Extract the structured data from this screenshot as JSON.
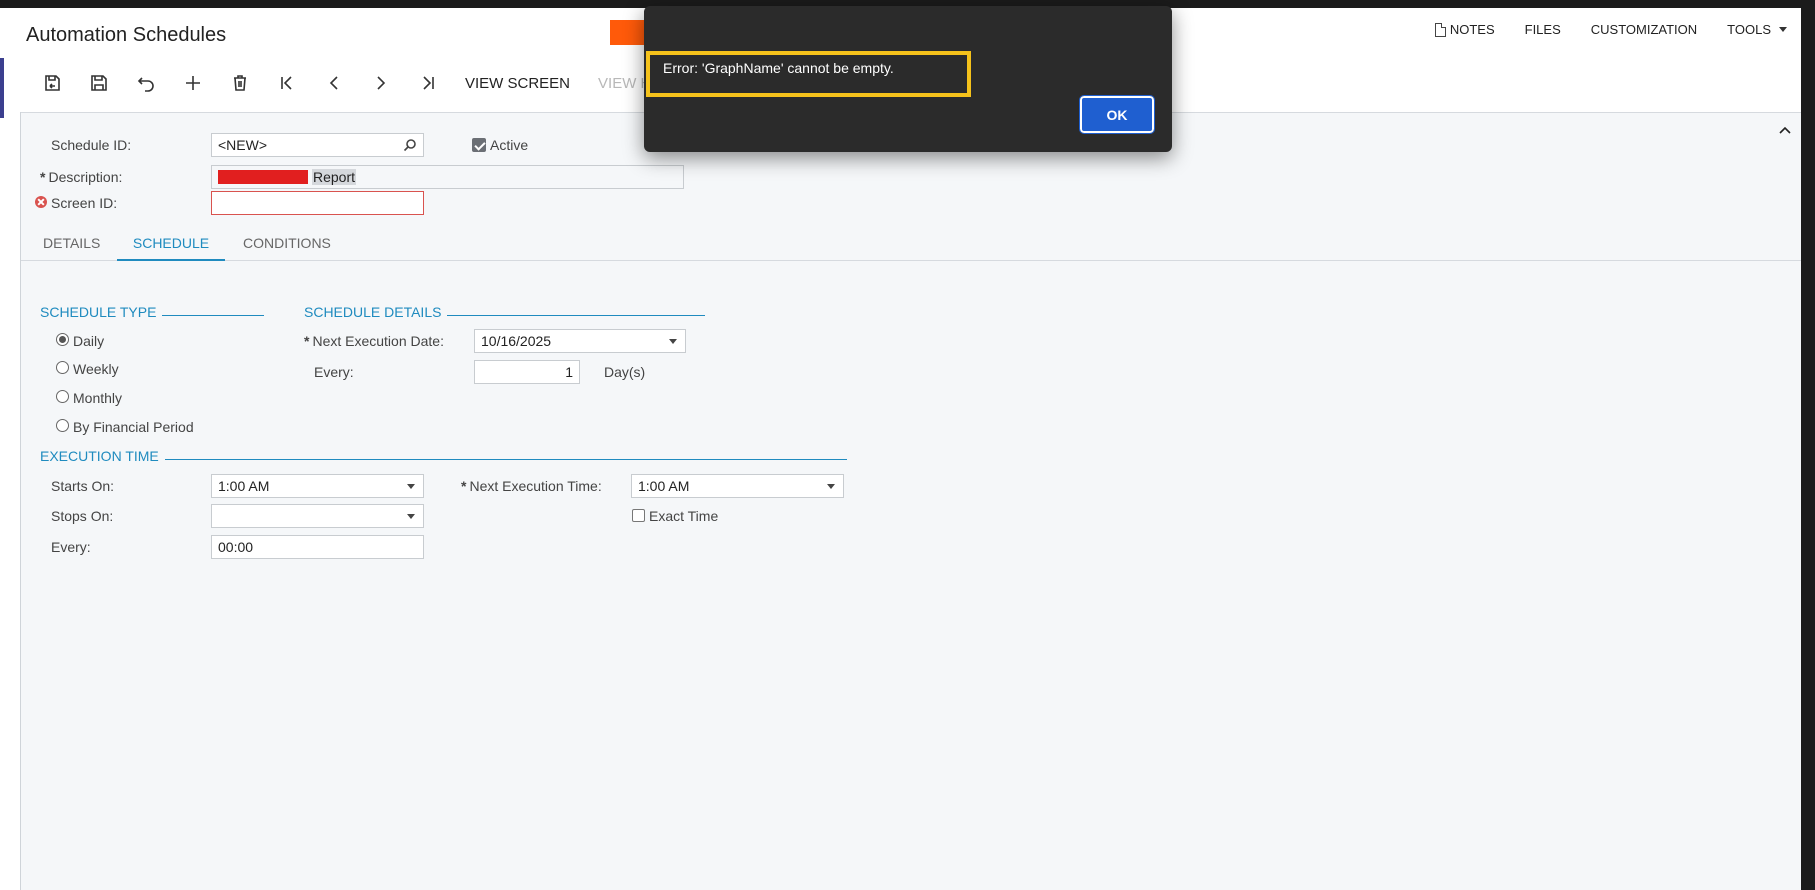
{
  "header": {
    "title": "Automation Schedules",
    "links": {
      "notes": "NOTES",
      "files": "FILES",
      "customization": "CUSTOMIZATION",
      "tools": "TOOLS"
    }
  },
  "toolbar": {
    "icons": [
      "save-close-icon",
      "save-icon",
      "undo-icon",
      "add-icon",
      "delete-icon",
      "first-icon",
      "previous-icon",
      "next-icon",
      "last-icon"
    ],
    "view_screen": "VIEW SCREEN",
    "view_h": "VIEW H"
  },
  "form": {
    "schedule_id_label": "Schedule ID:",
    "schedule_id_value": "<NEW>",
    "active_label": "Active",
    "active_checked": true,
    "description_label": "Description:",
    "description_value": "Report",
    "screen_id_label": "Screen ID:",
    "screen_id_value": ""
  },
  "tabs": {
    "details": "DETAILS",
    "schedule": "SCHEDULE",
    "conditions": "CONDITIONS",
    "active": "SCHEDULE"
  },
  "schedule_type": {
    "heading": "SCHEDULE TYPE",
    "options": [
      "Daily",
      "Weekly",
      "Monthly",
      "By Financial Period"
    ],
    "selected": "Daily"
  },
  "schedule_details": {
    "heading": "SCHEDULE DETAILS",
    "next_execution_date_label": "Next Execution Date:",
    "next_execution_date_value": "10/16/2025",
    "every_label": "Every:",
    "every_value": "1",
    "every_unit": "Day(s)"
  },
  "execution_time": {
    "heading": "EXECUTION TIME",
    "starts_on_label": "Starts On:",
    "starts_on_value": "1:00 AM",
    "stops_on_label": "Stops On:",
    "stops_on_value": "",
    "every_label": "Every:",
    "every_value": "00:00",
    "next_execution_time_label": "Next Execution Time:",
    "next_execution_time_value": "1:00 AM",
    "exact_time_label": "Exact Time",
    "exact_time_checked": false
  },
  "dialog": {
    "message": "Error: 'GraphName' cannot be empty.",
    "ok_label": "OK"
  },
  "colors": {
    "accent": "#1f8bbf",
    "error": "#d9534f",
    "dialog_bg": "#2b2b2b",
    "ok_button": "#1f5fd0",
    "highlight_box": "#f5c21b",
    "redaction_orange": "#ff5a0a",
    "redaction_red": "#e11f1f"
  }
}
